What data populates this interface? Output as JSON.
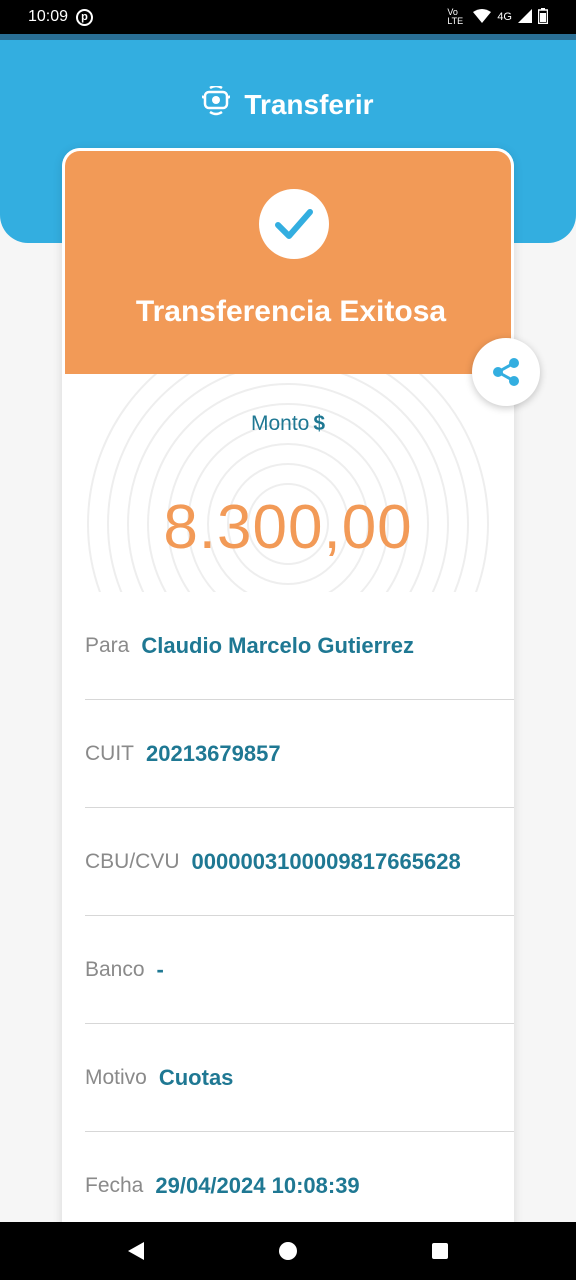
{
  "status_bar": {
    "time": "10:09",
    "notification_badge": "p",
    "network": "4G",
    "volte": "Vo LTE"
  },
  "header": {
    "title": "Transferir",
    "icon": "transfer-icon"
  },
  "card": {
    "success_title": "Transferencia Exitosa",
    "amount_label": "Monto",
    "currency_symbol": "$",
    "amount": "8.300,00"
  },
  "details": [
    {
      "label": "Para",
      "value": "Claudio Marcelo Gutierrez"
    },
    {
      "label": "CUIT",
      "value": "20213679857"
    },
    {
      "label": "CBU/CVU",
      "value": "0000003100009817665628"
    },
    {
      "label": "Banco",
      "value": "-"
    },
    {
      "label": "Motivo",
      "value": "Cuotas"
    },
    {
      "label": "Fecha",
      "value": "29/04/2024 10:08:39"
    }
  ],
  "colors": {
    "header_blue": "#33aee0",
    "success_orange": "#f29a57",
    "value_teal": "#1f7893"
  }
}
